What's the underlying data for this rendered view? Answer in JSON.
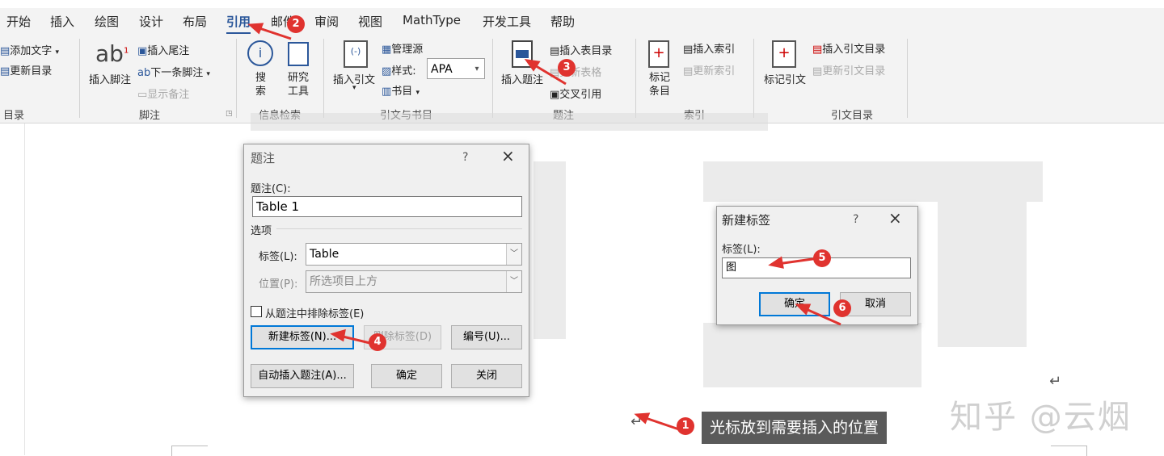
{
  "tabs": [
    "开始",
    "插入",
    "绘图",
    "设计",
    "布局",
    "引用",
    "邮件",
    "审阅",
    "视图",
    "MathType",
    "开发工具",
    "帮助"
  ],
  "active_tab": "引用",
  "ribbon": {
    "toc": {
      "add_text": "添加文字",
      "update_toc": "更新目录",
      "group": "目录"
    },
    "footnotes": {
      "insert_footnote": "插入脚注",
      "insert_endnote": "插入尾注",
      "next_footnote": "下一条脚注",
      "show_notes": "显示备注",
      "group": "脚注"
    },
    "research": {
      "search": "搜\n索",
      "researcher": "研究\n工具",
      "group": "信息检索"
    },
    "citations": {
      "insert_citation": "插入引文",
      "manage_sources": "管理源",
      "style_label": "样式:",
      "style_value": "APA",
      "bibliography": "书目",
      "group": "引文与书目"
    },
    "captions": {
      "insert_caption": "插入题注",
      "insert_tof": "插入表目录",
      "update_table": "更新表格",
      "cross_ref": "交叉引用",
      "group": "题注"
    },
    "index": {
      "mark_entry": "标记\n条目",
      "insert_index": "插入索引",
      "update_index": "更新索引",
      "group": "索引"
    },
    "toa": {
      "mark_citation": "标记引文",
      "insert_toa": "插入引文目录",
      "update_toa": "更新引文目录",
      "group": "引文目录"
    }
  },
  "caption_dialog": {
    "title": "题注",
    "help": "?",
    "caption_label": "题注(C):",
    "caption_value": "Table 1",
    "options_label": "选项",
    "label_label": "标签(L):",
    "label_value": "Table",
    "position_label": "位置(P):",
    "position_value": "所选项目上方",
    "exclude_label": "从题注中排除标签(E)",
    "new_label_btn": "新建标签(N)...",
    "delete_label_btn": "删除标签(D)",
    "numbering_btn": "编号(U)...",
    "autocaption_btn": "自动插入题注(A)...",
    "ok_btn": "确定",
    "close_btn": "关闭"
  },
  "new_label_dialog": {
    "title": "新建标签",
    "help": "?",
    "label_label": "标签(L):",
    "label_value": "图",
    "ok_btn": "确定",
    "cancel_btn": "取消"
  },
  "annotations": {
    "badges": [
      "1",
      "2",
      "3",
      "4",
      "5",
      "6"
    ],
    "callout": "光标放到需要插入的位置",
    "accent": "#e0332f"
  },
  "watermark": "知乎 @云烟"
}
